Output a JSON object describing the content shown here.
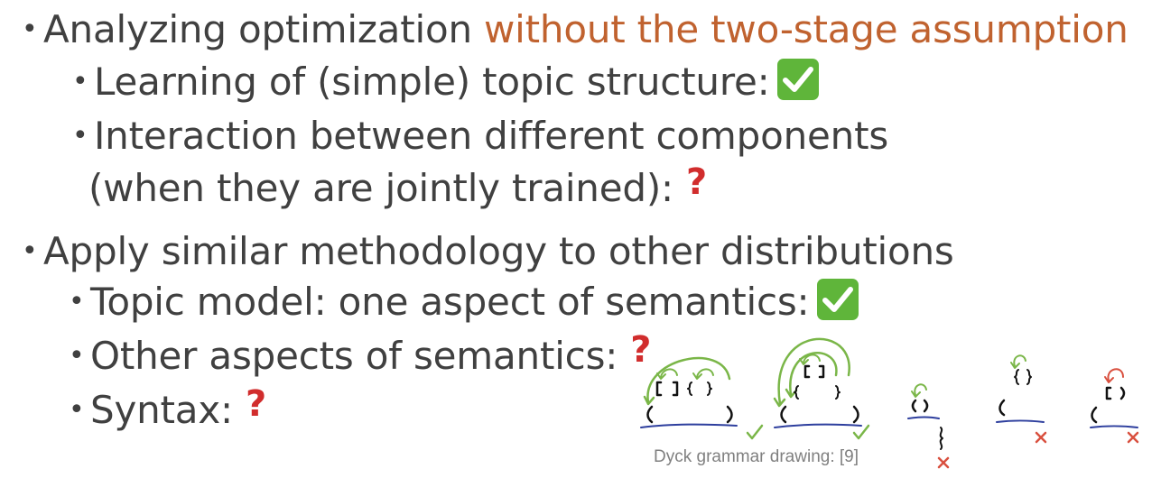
{
  "bullets": {
    "b1": {
      "text_prefix": "Analyzing optimization ",
      "text_accent": "without the two-stage assumption"
    },
    "b1a": {
      "text": "Learning of (simple) topic structure:",
      "status": "check-icon"
    },
    "b1b": {
      "text_line1": "Interaction between different components",
      "text_line2": "(when they are jointly trained):",
      "status_mark": "?"
    },
    "b2": {
      "text": "Apply similar methodology to other distributions"
    },
    "b2a": {
      "text": "Topic model: one aspect of semantics:",
      "status": "check-icon"
    },
    "b2b": {
      "text": "Other aspects of semantics:",
      "status_mark": "?"
    },
    "b2c": {
      "text": "Syntax:",
      "status_mark": "?"
    }
  },
  "bullet_glyph": "•",
  "figure": {
    "caption": "Dyck grammar drawing: [9]"
  },
  "colors": {
    "text": "#404040",
    "accent": "#c0622f",
    "check_bg": "#5fb53a",
    "question": "#d12d2d",
    "arc": "#7ab648",
    "underline": "#2e3f9e",
    "cross": "#d9503f"
  }
}
